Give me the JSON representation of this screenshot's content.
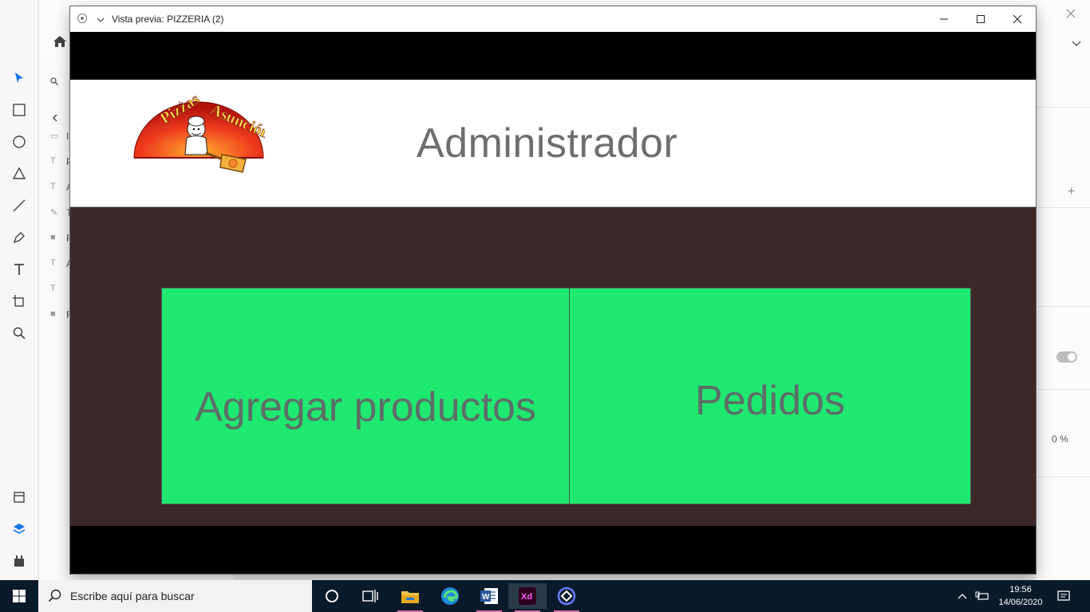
{
  "preview_window": {
    "title": "Vista previa: PIZZERIA (2)"
  },
  "app": {
    "header_title": "Administrador",
    "logo_text": "Pizzas la Asunción",
    "tiles": [
      {
        "label": "Agregar productos"
      },
      {
        "label": "Pedidos"
      }
    ],
    "colors": {
      "header_bg": "#ffffff",
      "main_bg": "#3d2829",
      "tile_bg": "#1fe870",
      "text": "#6e6e6e"
    }
  },
  "background_app": {
    "name": "Adobe XD",
    "right_panel_value": "0 %",
    "layer_initials": [
      "I",
      "P",
      "A",
      "T",
      "R",
      "A",
      "",
      "R"
    ]
  },
  "taskbar": {
    "search_placeholder": "Escribe aquí para buscar",
    "time": "19:56",
    "date": "14/06/2020",
    "apps": [
      "cortana-icon",
      "task-view-icon",
      "file-explorer-icon",
      "edge-icon",
      "word-icon",
      "xd-icon",
      "app-icon"
    ]
  }
}
